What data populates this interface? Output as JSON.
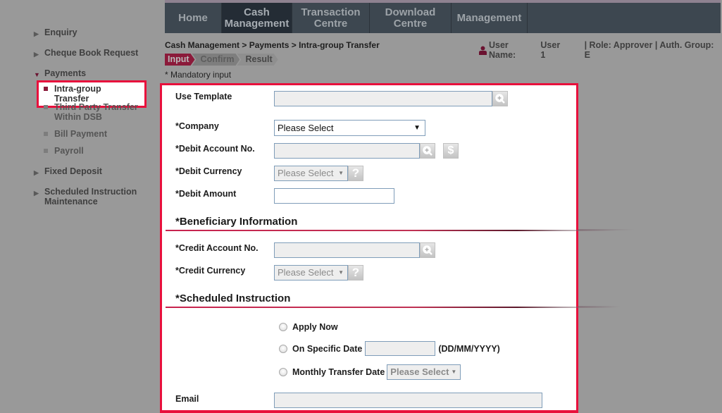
{
  "nav": {
    "items": [
      {
        "label": "Home"
      },
      {
        "label": "Cash Management",
        "line1": "Cash",
        "line2": "Management",
        "active": true
      },
      {
        "label": "Transaction Centre",
        "line1": "Transaction",
        "line2": "Centre"
      },
      {
        "label": "Download Centre",
        "line1": "Download",
        "line2": "Centre"
      },
      {
        "label": "Management"
      }
    ]
  },
  "sidebar": {
    "items": [
      {
        "label": "Enquiry"
      },
      {
        "label": "Cheque Book Request"
      },
      {
        "label": "Payments",
        "expanded": true,
        "children": [
          {
            "label": "Intra-group Transfer",
            "active": true
          },
          {
            "label": "Third Party Transfer Within DSB",
            "line1": "Third Party Transfer",
            "line2": "Within DSB"
          },
          {
            "label": "Bill Payment"
          },
          {
            "label": "Payroll"
          }
        ]
      },
      {
        "label": "Fixed Deposit"
      },
      {
        "label": "Scheduled Instruction Maintenance",
        "line1": "Scheduled Instruction",
        "line2": "Maintenance"
      }
    ]
  },
  "header": {
    "breadcrumb": "Cash Management > Payments > Intra-group Transfer",
    "user_label": "User Name:",
    "user_name": "User 1",
    "role_info": "| Role: Approver | Auth. Group: E",
    "steps": [
      "Input",
      "Confirm",
      "Result"
    ],
    "active_step": "Input",
    "mandatory_note": "* Mandatory input"
  },
  "form": {
    "use_template": {
      "label": "Use Template",
      "value": ""
    },
    "company": {
      "label": "*Company",
      "selected": "Please Select"
    },
    "debit_account": {
      "label": "*Debit Account No.",
      "value": ""
    },
    "debit_currency": {
      "label": "*Debit Currency",
      "selected": "Please Select"
    },
    "debit_amount": {
      "label": "*Debit Amount",
      "value": ""
    },
    "beneficiary_section": "*Beneficiary Information",
    "credit_account": {
      "label": "*Credit Account No.",
      "value": ""
    },
    "credit_currency": {
      "label": "*Credit Currency",
      "selected": "Please Select"
    },
    "scheduled_section": "*Scheduled Instruction",
    "schedule_options": {
      "apply_now": "Apply Now",
      "specific_date": "On Specific Date",
      "specific_date_value": "",
      "date_format": "(DD/MM/YYYY)",
      "monthly": "Monthly Transfer Date",
      "monthly_selected": "Please Select"
    },
    "email": {
      "label": "Email",
      "value": ""
    }
  },
  "colors": {
    "accent": "#e8103c",
    "brand": "#8b1a3a",
    "nav_bg": "#3d4750",
    "nav_active": "#242c35",
    "overlay_bg": "#999999"
  }
}
